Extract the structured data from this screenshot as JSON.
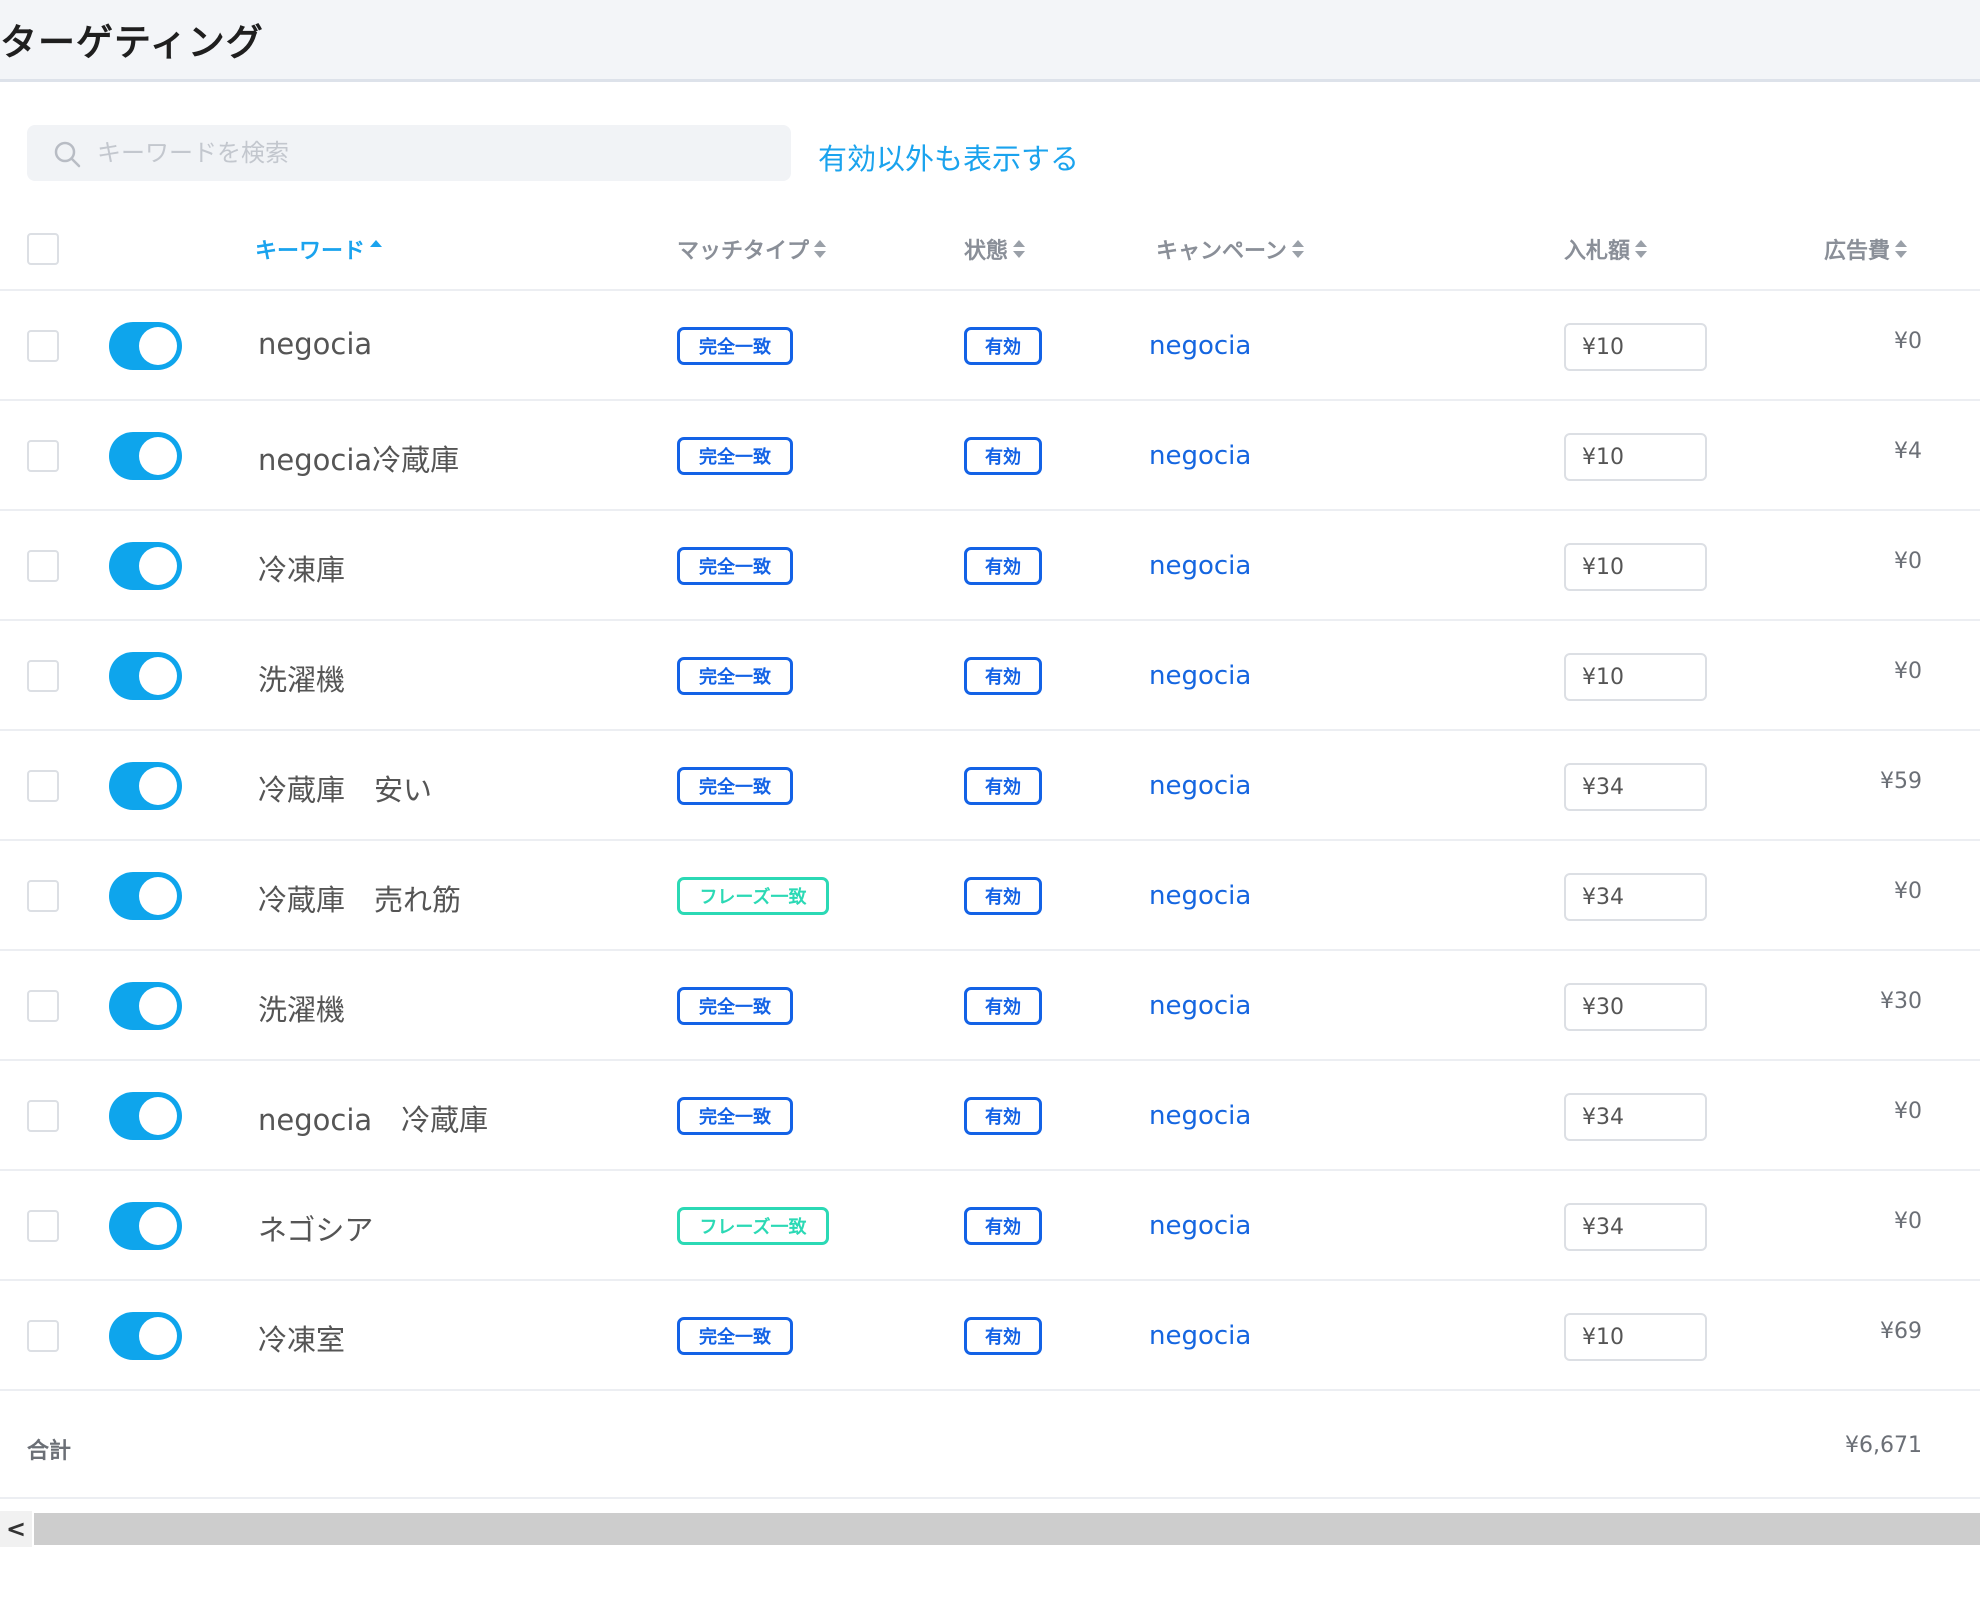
{
  "header": {
    "title": "ターゲティング"
  },
  "search": {
    "placeholder": "キーワードを検索"
  },
  "show_all_link": "有効以外も表示する",
  "columns": {
    "keyword": "キーワード",
    "match_type": "マッチタイプ",
    "status": "状態",
    "campaign": "キャンペーン",
    "bid": "入札額",
    "ad_cost": "広告費"
  },
  "rows": [
    {
      "keyword": "negocia",
      "match": "完全一致",
      "match_kind": "exact",
      "status": "有効",
      "campaign": "negocia",
      "bid": "¥10",
      "cost": "¥0"
    },
    {
      "keyword": "negocia冷蔵庫",
      "match": "完全一致",
      "match_kind": "exact",
      "status": "有効",
      "campaign": "negocia",
      "bid": "¥10",
      "cost": "¥4"
    },
    {
      "keyword": "冷凍庫",
      "match": "完全一致",
      "match_kind": "exact",
      "status": "有効",
      "campaign": "negocia",
      "bid": "¥10",
      "cost": "¥0"
    },
    {
      "keyword": "洗濯機",
      "match": "完全一致",
      "match_kind": "exact",
      "status": "有効",
      "campaign": "negocia",
      "bid": "¥10",
      "cost": "¥0"
    },
    {
      "keyword": "冷蔵庫　安い",
      "match": "完全一致",
      "match_kind": "exact",
      "status": "有効",
      "campaign": "negocia",
      "bid": "¥34",
      "cost": "¥59"
    },
    {
      "keyword": "冷蔵庫　売れ筋",
      "match": "フレーズ一致",
      "match_kind": "phrase",
      "status": "有効",
      "campaign": "negocia",
      "bid": "¥34",
      "cost": "¥0"
    },
    {
      "keyword": "洗濯機",
      "match": "完全一致",
      "match_kind": "exact",
      "status": "有効",
      "campaign": "negocia",
      "bid": "¥30",
      "cost": "¥30"
    },
    {
      "keyword": "negocia　冷蔵庫",
      "match": "完全一致",
      "match_kind": "exact",
      "status": "有効",
      "campaign": "negocia",
      "bid": "¥34",
      "cost": "¥0"
    },
    {
      "keyword": "ネゴシア",
      "match": "フレーズ一致",
      "match_kind": "phrase",
      "status": "有効",
      "campaign": "negocia",
      "bid": "¥34",
      "cost": "¥0"
    },
    {
      "keyword": "冷凍室",
      "match": "完全一致",
      "match_kind": "exact",
      "status": "有効",
      "campaign": "negocia",
      "bid": "¥10",
      "cost": "¥69"
    }
  ],
  "total": {
    "label": "合計",
    "value": "¥6,671"
  },
  "scrollbar": {
    "left_arrow": "<"
  },
  "colors": {
    "accent": "#1aa3ee",
    "toggle_on": "#0ea5ec",
    "exact_badge": "#1362e6",
    "phrase_badge": "#2bd9b5",
    "campaign_link": "#1566e0"
  }
}
